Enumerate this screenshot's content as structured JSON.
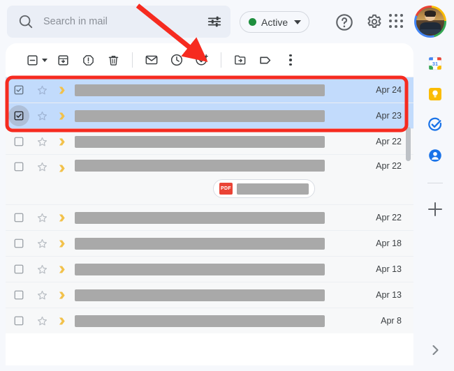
{
  "app": {
    "name": "gmail-inbox"
  },
  "header": {
    "search": {
      "placeholder": "Search in mail",
      "value": "",
      "icon": "search-icon",
      "filter_icon": "tune-icon"
    },
    "status": {
      "label": "Active",
      "dot_color": "#1e8e3e",
      "caret": "chevron-down-icon"
    },
    "help_icon": "help-icon",
    "settings_icon": "gear-icon",
    "apps_icon": "apps-grid-icon",
    "avatar": "account-avatar"
  },
  "toolbar": {
    "items": [
      {
        "name": "select-all-checkbox",
        "icon": "checkbox-indeterminate-icon"
      },
      {
        "name": "select-all-dropdown",
        "icon": "chevron-down-icon"
      },
      {
        "name": "archive-button",
        "icon": "archive-icon"
      },
      {
        "name": "report-spam-button",
        "icon": "report-spam-icon"
      },
      {
        "name": "delete-button",
        "icon": "trash-icon"
      },
      {
        "name": "mark-unread-button",
        "icon": "envelope-icon"
      },
      {
        "name": "snooze-button",
        "icon": "clock-icon"
      },
      {
        "name": "add-to-tasks-button",
        "icon": "task-add-icon"
      },
      {
        "name": "move-to-button",
        "icon": "folder-move-icon"
      },
      {
        "name": "labels-button",
        "icon": "label-icon"
      },
      {
        "name": "more-options-button",
        "icon": "more-vertical-icon"
      }
    ]
  },
  "message_list": {
    "rows": [
      {
        "date": "Apr 24",
        "selected": true,
        "checked": true,
        "starred": false,
        "important": true,
        "attachment": null,
        "hover": false
      },
      {
        "date": "Apr 23",
        "selected": true,
        "checked": true,
        "starred": false,
        "important": true,
        "attachment": null,
        "hover": true
      },
      {
        "date": "Apr 22",
        "selected": false,
        "checked": false,
        "starred": false,
        "important": true,
        "attachment": null,
        "hover": false
      },
      {
        "date": "Apr 22",
        "selected": false,
        "checked": false,
        "starred": false,
        "important": true,
        "attachment": {
          "type": "PDF",
          "badge_label": "PDF",
          "badge_color": "#ea4335"
        },
        "hover": false
      },
      {
        "date": "Apr 22",
        "selected": false,
        "checked": false,
        "starred": false,
        "important": true,
        "attachment": null,
        "hover": false
      },
      {
        "date": "Apr 18",
        "selected": false,
        "checked": false,
        "starred": false,
        "important": true,
        "attachment": null,
        "hover": false
      },
      {
        "date": "Apr 13",
        "selected": false,
        "checked": false,
        "starred": false,
        "important": true,
        "attachment": null,
        "hover": false
      },
      {
        "date": "Apr 13",
        "selected": false,
        "checked": false,
        "starred": false,
        "important": true,
        "attachment": null,
        "hover": false
      },
      {
        "date": "Apr 8",
        "selected": false,
        "checked": false,
        "starred": false,
        "important": true,
        "attachment": null,
        "hover": false
      }
    ],
    "selection_highlight_color": "#c2dbfc",
    "redaction_color": "#a9a9a9"
  },
  "side_panel": {
    "items": [
      {
        "name": "google-calendar-icon",
        "label": "31"
      },
      {
        "name": "google-keep-icon",
        "label": ""
      },
      {
        "name": "google-tasks-icon",
        "label": ""
      },
      {
        "name": "google-contacts-icon",
        "label": ""
      }
    ],
    "add_button": "add-on-plus-icon",
    "expand_button": "chevron-right-icon"
  },
  "annotations": {
    "arrow": {
      "color": "#f62b20",
      "points_to": "snooze-button"
    },
    "highlight_box": {
      "color": "#f62b20",
      "surrounds": "selected-message-rows"
    }
  }
}
